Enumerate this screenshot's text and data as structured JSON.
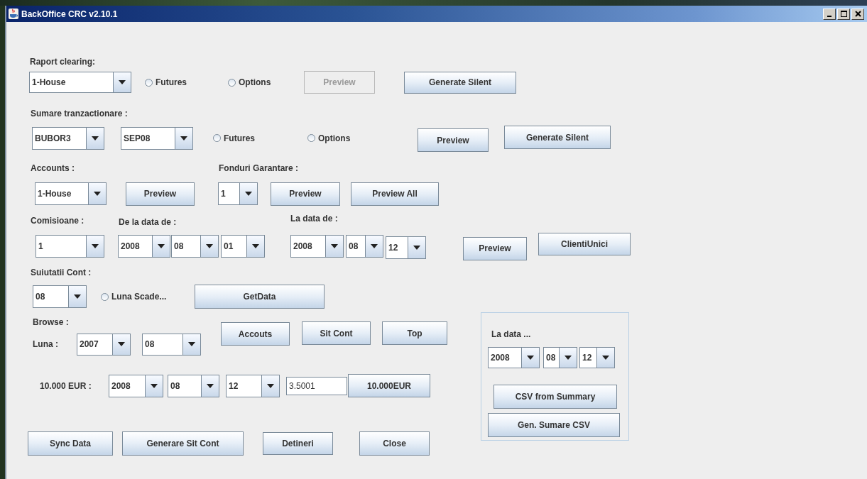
{
  "window": {
    "title": "BackOffice CRC v2.10.1"
  },
  "raport_clearing": {
    "label": "Raport clearing:",
    "account": "1-House",
    "futures": {
      "label": "Futures",
      "selected": false
    },
    "options": {
      "label": "Options",
      "selected": false
    },
    "preview": {
      "label": "Preview",
      "disabled": true
    },
    "generate": {
      "label": "Generate Silent",
      "disabled": false
    }
  },
  "sumare": {
    "label": "Sumare tranzactionare :",
    "instrument": "BUBOR3",
    "maturity": "SEP08",
    "futures": {
      "label": "Futures",
      "selected": false
    },
    "options": {
      "label": "Options",
      "selected": false
    },
    "preview": {
      "label": "Preview",
      "disabled": false
    },
    "generate": {
      "label": "Generate Silent",
      "disabled": false
    }
  },
  "accounts": {
    "label": "Accounts :",
    "account": "1-House",
    "preview": {
      "label": "Preview",
      "disabled": false
    }
  },
  "fonduri": {
    "label": "Fonduri Garantare :",
    "value": "1",
    "preview": {
      "label": "Preview",
      "disabled": false
    },
    "preview_all": {
      "label": "Preview All",
      "disabled": false
    }
  },
  "comisioane": {
    "label": "Comisioane :",
    "value": "1",
    "from_label": "De la data de :",
    "from": [
      "2008",
      "08",
      "01"
    ],
    "to_label": "La data de :",
    "to": [
      "2008",
      "08",
      "12"
    ],
    "preview": {
      "label": "Preview",
      "disabled": false
    },
    "clienti": {
      "label": "ClientiUnici",
      "disabled": false
    }
  },
  "situatii": {
    "label": "Suiutatii Cont :",
    "month": "08",
    "luna_scadenta": {
      "label": "Luna Scade...",
      "selected": false
    },
    "get_data": {
      "label": "GetData",
      "disabled": false
    }
  },
  "browse": {
    "label": "Browse :",
    "luna_label": "Luna :",
    "year": "2007",
    "month": "08",
    "accounts": {
      "label": "Accouts",
      "disabled": false
    },
    "sit_cont": {
      "label": "Sit Cont",
      "disabled": false
    },
    "top": {
      "label": "Top",
      "disabled": false
    }
  },
  "eur": {
    "label": "10.000 EUR :",
    "date": [
      "2008",
      "08",
      "12"
    ],
    "rate": "3.5001",
    "button": {
      "label": "10.000EUR",
      "disabled": false
    }
  },
  "la_data": {
    "label": "La data ...",
    "date": [
      "2008",
      "08",
      "12"
    ],
    "csv_summary": {
      "label": "CSV from Summary",
      "disabled": false
    },
    "gen_sumare": {
      "label": "Gen. Sumare CSV",
      "disabled": false
    }
  },
  "footer": [
    {
      "label": "Sync Data",
      "disabled": false
    },
    {
      "label": "Generare Sit Cont",
      "disabled": false
    },
    {
      "label": "Detineri",
      "disabled": false
    },
    {
      "label": "Close",
      "disabled": false
    }
  ]
}
